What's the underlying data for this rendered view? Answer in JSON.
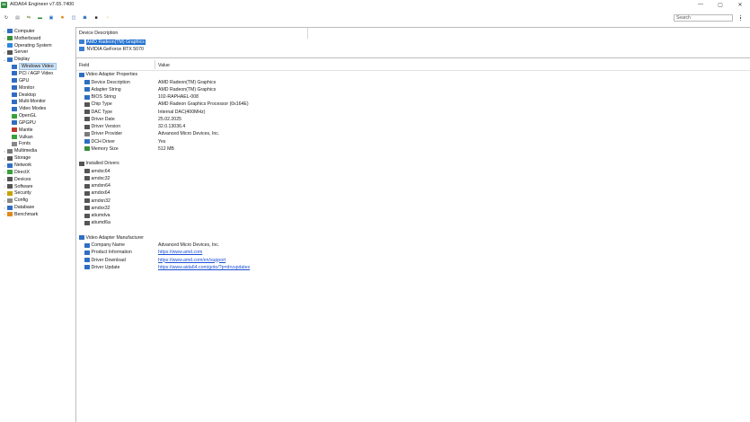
{
  "window": {
    "logo_text": "64",
    "title": "AIDA64 Engineer v7.65.7400",
    "controls": [
      "—",
      "▢",
      "✕"
    ]
  },
  "toolbar": {
    "icons": [
      {
        "name": "refresh-icon",
        "glyph": "↻",
        "color": "#333333"
      },
      {
        "name": "report-icon",
        "glyph": "▤",
        "color": "#7a7a7a"
      },
      {
        "name": "network-link-icon",
        "glyph": "⇆",
        "color": "#6a8a3a"
      },
      {
        "name": "memory-module-icon",
        "glyph": "▬",
        "color": "#2e8b3a"
      },
      {
        "name": "cpu-id-icon",
        "glyph": "▣",
        "color": "#1c6fbf"
      },
      {
        "name": "flame-icon",
        "glyph": "✹",
        "color": "#e08a1a"
      },
      {
        "name": "disk-benchmark-icon",
        "glyph": "◫",
        "color": "#3d6fb5"
      },
      {
        "name": "users-icon",
        "glyph": "☗",
        "color": "#3a7cc9"
      },
      {
        "name": "sensor-panel-icon",
        "glyph": "■",
        "color": "#222222"
      },
      {
        "name": "stress-test-icon",
        "glyph": "◔",
        "color": "#e2a300"
      }
    ],
    "search_placeholder": "Search"
  },
  "tree": [
    {
      "label": "Computer",
      "level": 0,
      "chev": "›",
      "color": "#2f6ec2",
      "name": "computer"
    },
    {
      "label": "Motherboard",
      "level": 0,
      "chev": "›",
      "color": "#3a8f3a",
      "name": "motherboard"
    },
    {
      "label": "Operating System",
      "level": 0,
      "chev": "›",
      "color": "#2e86de",
      "name": "operating-system"
    },
    {
      "label": "Server",
      "level": 0,
      "chev": "›",
      "color": "#555555",
      "name": "server"
    },
    {
      "label": "Display",
      "level": 0,
      "chev": "⌄",
      "color": "#2f6ec2",
      "name": "display"
    },
    {
      "label": "Windows Video",
      "level": 1,
      "chev": "",
      "color": "#2f6ec2",
      "name": "windows-video",
      "selected": true
    },
    {
      "label": "PCI / AGP Video",
      "level": 1,
      "chev": "",
      "color": "#2f6ec2",
      "name": "pci-agp-video"
    },
    {
      "label": "GPU",
      "level": 1,
      "chev": "",
      "color": "#2f6ec2",
      "name": "gpu"
    },
    {
      "label": "Monitor",
      "level": 1,
      "chev": "",
      "color": "#2f6ec2",
      "name": "monitor"
    },
    {
      "label": "Desktop",
      "level": 1,
      "chev": "",
      "color": "#2f6ec2",
      "name": "desktop"
    },
    {
      "label": "Multi-Monitor",
      "level": 1,
      "chev": "",
      "color": "#2f6ec2",
      "name": "multi-monitor"
    },
    {
      "label": "Video Modes",
      "level": 1,
      "chev": "",
      "color": "#2f6ec2",
      "name": "video-modes"
    },
    {
      "label": "OpenGL",
      "level": 1,
      "chev": "",
      "color": "#3aa03a",
      "name": "opengl"
    },
    {
      "label": "GPGPU",
      "level": 1,
      "chev": "",
      "color": "#2f6ec2",
      "name": "gpgpu"
    },
    {
      "label": "Mantle",
      "level": 1,
      "chev": "",
      "color": "#c0392b",
      "name": "mantle"
    },
    {
      "label": "Vulkan",
      "level": 1,
      "chev": "",
      "color": "#3aa03a",
      "name": "vulkan"
    },
    {
      "label": "Fonts",
      "level": 1,
      "chev": "",
      "color": "#888888",
      "name": "fonts"
    },
    {
      "label": "Multimedia",
      "level": 0,
      "chev": "›",
      "color": "#7a7a7a",
      "name": "multimedia"
    },
    {
      "label": "Storage",
      "level": 0,
      "chev": "›",
      "color": "#555555",
      "name": "storage"
    },
    {
      "label": "Network",
      "level": 0,
      "chev": "›",
      "color": "#2f6ec2",
      "name": "network"
    },
    {
      "label": "DirectX",
      "level": 0,
      "chev": "›",
      "color": "#3aa03a",
      "name": "directx"
    },
    {
      "label": "Devices",
      "level": 0,
      "chev": "›",
      "color": "#555555",
      "name": "devices"
    },
    {
      "label": "Software",
      "level": 0,
      "chev": "›",
      "color": "#555555",
      "name": "software"
    },
    {
      "label": "Security",
      "level": 0,
      "chev": "›",
      "color": "#c8a200",
      "name": "security"
    },
    {
      "label": "Config",
      "level": 0,
      "chev": "›",
      "color": "#888888",
      "name": "config"
    },
    {
      "label": "Database",
      "level": 0,
      "chev": "›",
      "color": "#2f6ec2",
      "name": "database"
    },
    {
      "label": "Benchmark",
      "level": 0,
      "chev": "›",
      "color": "#e08a1a",
      "name": "benchmark"
    }
  ],
  "device_pane": {
    "header": "Device Description",
    "devices": [
      {
        "label": "AMD Radeon(TM) Graphics",
        "selected": true
      },
      {
        "label": "NVIDIA GeForce RTX 5070",
        "selected": false
      }
    ]
  },
  "details": {
    "col_field": "Field",
    "col_value": "Value",
    "rows": [
      {
        "type": "group",
        "field": "Video Adapter Properties",
        "color": "#2f6ec2"
      },
      {
        "type": "item",
        "field": "Device Description",
        "value": "AMD Radeon(TM) Graphics",
        "color": "#2f6ec2"
      },
      {
        "type": "item",
        "field": "Adapter String",
        "value": "AMD Radeon(TM) Graphics",
        "color": "#2f6ec2"
      },
      {
        "type": "item",
        "field": "BIOS String",
        "value": "102-RAPHAEL-008",
        "color": "#2f6ec2"
      },
      {
        "type": "item",
        "field": "Chip Type",
        "value": "AMD Radeon Graphics Processor (0x164E)",
        "color": "#555555"
      },
      {
        "type": "item",
        "field": "DAC Type",
        "value": "Internal DAC(400MHz)",
        "color": "#555555"
      },
      {
        "type": "item",
        "field": "Driver Date",
        "value": "25.02.2025",
        "color": "#555555"
      },
      {
        "type": "item",
        "field": "Driver Version",
        "value": "32.0.13036.4",
        "color": "#555555"
      },
      {
        "type": "item",
        "field": "Driver Provider",
        "value": "Advanced Micro Devices, Inc.",
        "color": "#7a7a7a"
      },
      {
        "type": "item",
        "field": "DCH Driver",
        "value": "Yes",
        "color": "#2f6ec2"
      },
      {
        "type": "item",
        "field": "Memory Size",
        "value": "512 MB",
        "color": "#3a8f3a"
      },
      {
        "type": "spacer"
      },
      {
        "type": "group",
        "field": "Installed Drivers",
        "color": "#555555"
      },
      {
        "type": "item",
        "field": "amdxc64",
        "value": "",
        "color": "#555555"
      },
      {
        "type": "item",
        "field": "amdxc32",
        "value": "",
        "color": "#555555"
      },
      {
        "type": "item",
        "field": "amdxn64",
        "value": "",
        "color": "#555555"
      },
      {
        "type": "item",
        "field": "amdxx64",
        "value": "",
        "color": "#555555"
      },
      {
        "type": "item",
        "field": "amdxn32",
        "value": "",
        "color": "#555555"
      },
      {
        "type": "item",
        "field": "amdxx32",
        "value": "",
        "color": "#555555"
      },
      {
        "type": "item",
        "field": "atiumdva",
        "value": "",
        "color": "#555555"
      },
      {
        "type": "item",
        "field": "atiumd6a",
        "value": "",
        "color": "#555555"
      },
      {
        "type": "spacer"
      },
      {
        "type": "group",
        "field": "Video Adapter Manufacturer",
        "color": "#2f6ec2"
      },
      {
        "type": "item",
        "field": "Company Name",
        "value": "Advanced Micro Devices, Inc.",
        "color": "#2f6ec2"
      },
      {
        "type": "item",
        "field": "Product Information",
        "value": "https://www.amd.com",
        "link": true,
        "color": "#2f6ec2"
      },
      {
        "type": "item",
        "field": "Driver Download",
        "value": "https://www.amd.com/en/support",
        "link": true,
        "color": "#2f6ec2"
      },
      {
        "type": "item",
        "field": "Driver Update",
        "value": "https://www.aida64.com/goto/?p=drvupdates",
        "link": true,
        "color": "#2f6ec2"
      }
    ]
  }
}
